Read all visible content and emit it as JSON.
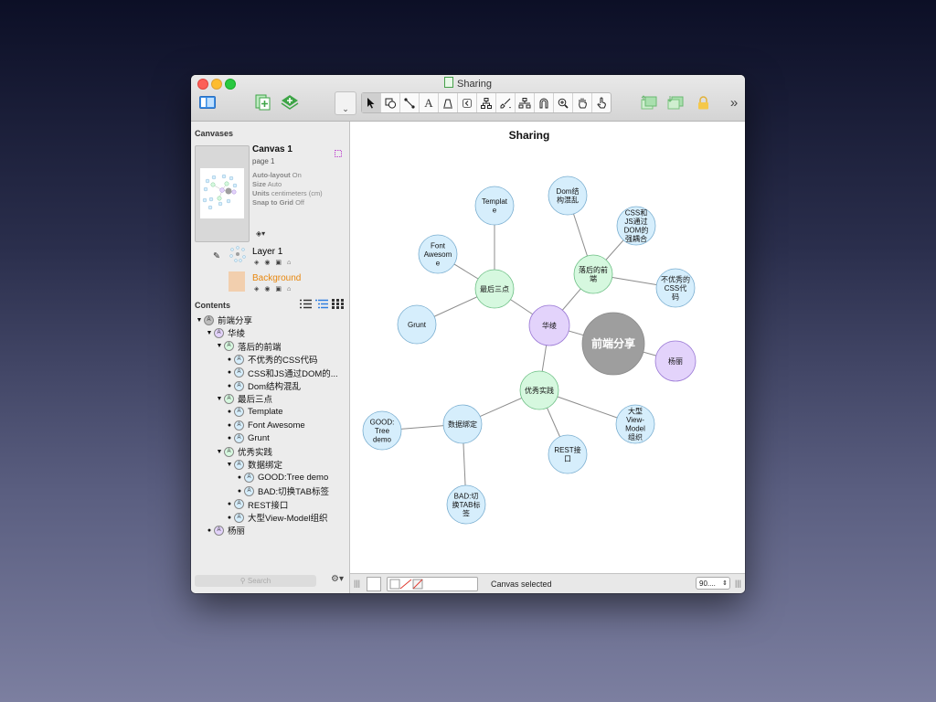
{
  "window": {
    "title": "Sharing"
  },
  "toolbar": {
    "left_tools": [
      "sidebar-toggle-icon",
      "new-canvas-icon",
      "new-layer-icon"
    ],
    "style_menu_label": "⌄",
    "tools": [
      "pointer-icon",
      "shape-icon",
      "line-icon",
      "text-icon",
      "pen-icon",
      "back-icon",
      "diagram-icon",
      "style-brush-icon",
      "selection-icon",
      "magnet-icon",
      "zoom-icon",
      "hand-icon",
      "browse-icon"
    ],
    "right_tools": [
      "bring-forward-icon",
      "send-backward-icon",
      "lock-icon"
    ],
    "overflow_label": "»"
  },
  "sidebar": {
    "canvases_heading": "Canvases",
    "canvas": {
      "name": "Canvas 1",
      "page": "page 1",
      "properties": [
        {
          "label": "Auto-layout",
          "value": "On"
        },
        {
          "label": "Size",
          "value": "Auto"
        },
        {
          "label": "Units",
          "value": "centimeters (cm)"
        },
        {
          "label": "Snap to Grid",
          "value": "Off"
        }
      ]
    },
    "layers": [
      {
        "name": "Layer 1",
        "color": "#222222"
      },
      {
        "name": "Background",
        "color": "#e8870e"
      }
    ],
    "contents_heading": "Contents",
    "tree": [
      {
        "label": "前端分享",
        "depth": 0,
        "type": "arrow",
        "badge": "#bdbdbd"
      },
      {
        "label": "华绫",
        "depth": 1,
        "type": "arrow",
        "badge": "#e3d3fb"
      },
      {
        "label": "落后的前端",
        "depth": 2,
        "type": "arrow",
        "badge": "#d6f8df"
      },
      {
        "label": "不优秀的CSS代码",
        "depth": 3,
        "type": "bullet",
        "badge": "#d6eefc"
      },
      {
        "label": "CSS和JS通过DOM的...",
        "depth": 3,
        "type": "bullet",
        "badge": "#d6eefc"
      },
      {
        "label": "Dom结构混乱",
        "depth": 3,
        "type": "bullet",
        "badge": "#d6eefc"
      },
      {
        "label": "最后三点",
        "depth": 2,
        "type": "arrow",
        "badge": "#d6f8df"
      },
      {
        "label": "Template",
        "depth": 3,
        "type": "bullet",
        "badge": "#d6eefc"
      },
      {
        "label": "Font Awesome",
        "depth": 3,
        "type": "bullet",
        "badge": "#d6eefc"
      },
      {
        "label": "Grunt",
        "depth": 3,
        "type": "bullet",
        "badge": "#d6eefc"
      },
      {
        "label": "优秀实践",
        "depth": 2,
        "type": "arrow",
        "badge": "#d6f8df"
      },
      {
        "label": "数据绑定",
        "depth": 3,
        "type": "arrow",
        "badge": "#d6eefc"
      },
      {
        "label": "GOOD:Tree demo",
        "depth": 4,
        "type": "bullet",
        "badge": "#d6eefc"
      },
      {
        "label": "BAD:切换TAB标签",
        "depth": 4,
        "type": "bullet",
        "badge": "#d6eefc"
      },
      {
        "label": "REST接口",
        "depth": 3,
        "type": "bullet",
        "badge": "#d6eefc"
      },
      {
        "label": "大型View-Model组织",
        "depth": 3,
        "type": "bullet",
        "badge": "#d6eefc"
      },
      {
        "label": "杨丽",
        "depth": 1,
        "type": "bullet",
        "badge": "#e3d3fb"
      }
    ],
    "search_placeholder": "Search"
  },
  "canvas": {
    "title": "Sharing",
    "colors": {
      "root": "#9e9e9e",
      "purple": "#e3d3fb",
      "green": "#d6f8df",
      "blue": "#d6eefc",
      "edge": "#8c8c8c"
    },
    "nodes": [
      {
        "id": "root",
        "label": "前端分享",
        "color": "root"
      },
      {
        "id": "hualing",
        "label": "华绫",
        "color": "purple"
      },
      {
        "id": "yangli",
        "label": "杨丽",
        "color": "purple"
      },
      {
        "id": "luohou",
        "label": "落后的前端",
        "color": "green"
      },
      {
        "id": "zuihou",
        "label": "最后三点",
        "color": "green"
      },
      {
        "id": "youxiu",
        "label": "优秀实践",
        "color": "green"
      },
      {
        "id": "shuju",
        "label": "数据绑定",
        "color": "blue"
      },
      {
        "id": "css_bad",
        "label": "不优秀的CSS代码",
        "color": "blue"
      },
      {
        "id": "css_js",
        "label": "CSS和JS通过DOM的强耦合",
        "color": "blue"
      },
      {
        "id": "dom",
        "label": "Dom结构混乱",
        "color": "blue"
      },
      {
        "id": "template",
        "label": "Template",
        "color": "blue"
      },
      {
        "id": "fontawesome",
        "label": "Font Awesome",
        "color": "blue"
      },
      {
        "id": "grunt",
        "label": "Grunt",
        "color": "blue"
      },
      {
        "id": "good",
        "label": "GOOD:Tree demo",
        "color": "blue"
      },
      {
        "id": "bad",
        "label": "BAD:切换TAB标签",
        "color": "blue"
      },
      {
        "id": "rest",
        "label": "REST接口",
        "color": "blue"
      },
      {
        "id": "viewmodel",
        "label": "大型View-Model组织",
        "color": "blue"
      }
    ],
    "edges": [
      [
        "root",
        "hualing"
      ],
      [
        "root",
        "yangli"
      ],
      [
        "hualing",
        "luohou"
      ],
      [
        "hualing",
        "zuihou"
      ],
      [
        "hualing",
        "youxiu"
      ],
      [
        "luohou",
        "css_bad"
      ],
      [
        "luohou",
        "css_js"
      ],
      [
        "luohou",
        "dom"
      ],
      [
        "zuihou",
        "template"
      ],
      [
        "zuihou",
        "fontawesome"
      ],
      [
        "zuihou",
        "grunt"
      ],
      [
        "youxiu",
        "shuju"
      ],
      [
        "youxiu",
        "rest"
      ],
      [
        "youxiu",
        "viewmodel"
      ],
      [
        "shuju",
        "good"
      ],
      [
        "shuju",
        "bad"
      ]
    ]
  },
  "statusbar": {
    "status_text": "Canvas selected",
    "zoom": "90...."
  }
}
